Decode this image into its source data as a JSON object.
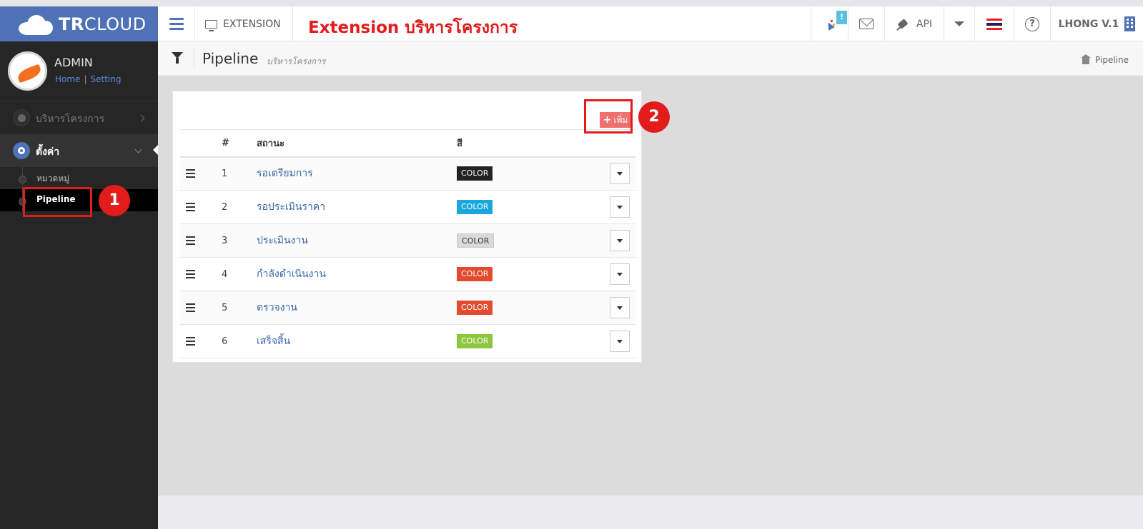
{
  "header": {
    "logo_text_bold": "TR",
    "logo_text_light": "CLOUD",
    "extension_label": "EXTENSION",
    "headline": "Extension บริหารโครงการ",
    "new_badge": "!",
    "api_label": "API",
    "help_symbol": "?",
    "user_name": "LHONG V.1"
  },
  "sidebar": {
    "profile_name": "ADMIN",
    "link_home": "Home",
    "link_separator": "|",
    "link_setting": "Setting",
    "menu_project": "บริหารโครงการ",
    "menu_settings": "ตั้งค่า",
    "sub_category": "หมวดหมู่",
    "sub_pipeline": "Pipeline"
  },
  "callouts": {
    "one": "1",
    "two": "2"
  },
  "page": {
    "title": "Pipeline",
    "subtitle": "บริหารโครงการ",
    "breadcrumb": "Pipeline"
  },
  "panel": {
    "add_button_plus": "+",
    "add_button_label": "เพิ่ม",
    "table": {
      "col_num": "#",
      "col_status": "สถานะ",
      "col_color": "สี",
      "rows": [
        {
          "num": "1",
          "status": "รอเตรียมการ",
          "color_label": "COLOR",
          "color": "#222222",
          "text_color": "#ffffff"
        },
        {
          "num": "2",
          "status": "รอประเมินราคา",
          "color_label": "COLOR",
          "color": "#1aa7de",
          "text_color": "#ffffff"
        },
        {
          "num": "3",
          "status": "ประเมินงาน",
          "color_label": "COLOR",
          "color": "#d9d9d9",
          "text_color": "#333333"
        },
        {
          "num": "4",
          "status": "กำลังดำเนินงาน",
          "color_label": "COLOR",
          "color": "#e34b2e",
          "text_color": "#ffffff"
        },
        {
          "num": "5",
          "status": "ตรวจงาน",
          "color_label": "COLOR",
          "color": "#e34b2e",
          "text_color": "#ffffff"
        },
        {
          "num": "6",
          "status": "เสร็จสิ้น",
          "color_label": "COLOR",
          "color": "#8dc63f",
          "text_color": "#ffffff"
        }
      ]
    }
  },
  "colors": {
    "brand": "#4f72b6",
    "accent_red": "#e21b1b"
  }
}
